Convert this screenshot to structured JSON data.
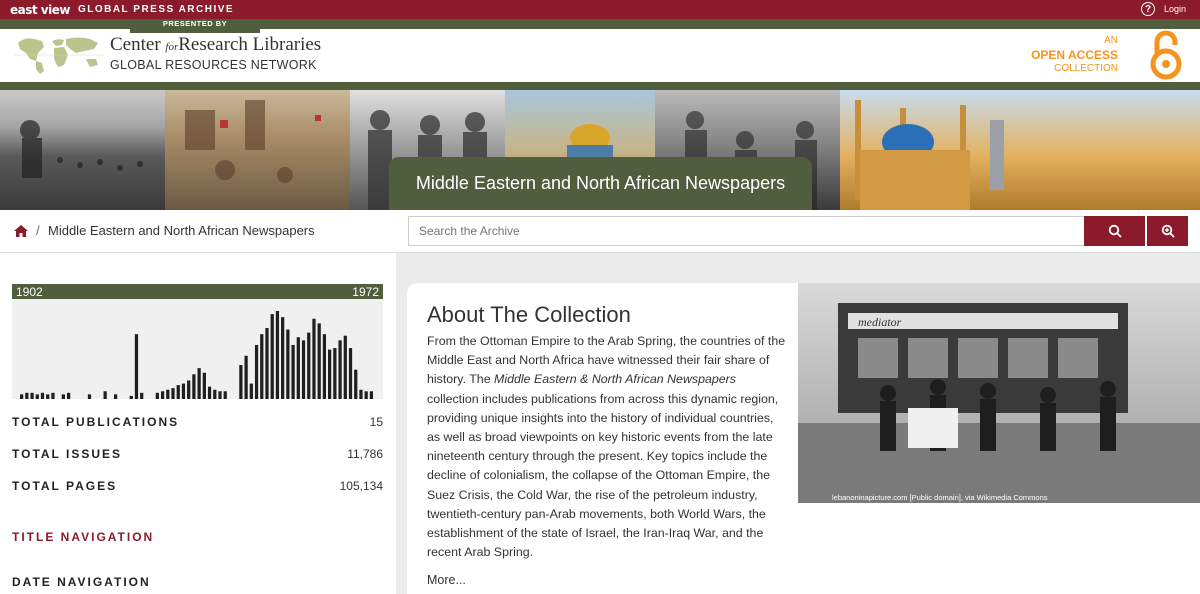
{
  "topbar": {
    "brand": "east view",
    "subtitle": "GLOBAL PRESS ARCHIVE",
    "help": "?",
    "login": "Login"
  },
  "header": {
    "presented_by": "PRESENTED BY",
    "crl_title_part1": "Center",
    "crl_title_for": "for",
    "crl_title_part2": "Research Libraries",
    "crl_network": "GLOBAL RESOURCES NETWORK",
    "oa_line1": "AN",
    "oa_line2": "OPEN ACCESS",
    "oa_line3": "COLLECTION"
  },
  "banner": {
    "title": "Middle Eastern and North African Newspapers"
  },
  "breadcrumb": {
    "separator": "/",
    "current": "Middle Eastern and North African Newspapers"
  },
  "search": {
    "placeholder": "Search the Archive"
  },
  "sidebar": {
    "year_start": "1902",
    "year_end": "1972",
    "stats": [
      {
        "label": "TOTAL PUBLICATIONS",
        "value": "15"
      },
      {
        "label": "TOTAL ISSUES",
        "value": "11,786"
      },
      {
        "label": "TOTAL PAGES",
        "value": "105,134"
      }
    ],
    "title_nav": "TITLE NAVIGATION",
    "date_nav": "DATE NAVIGATION"
  },
  "chart_data": {
    "type": "bar",
    "xlim": [
      1902,
      1972
    ],
    "values": [
      3,
      4,
      4,
      3,
      4,
      3,
      4,
      0,
      3,
      4,
      0,
      0,
      0,
      3,
      0,
      0,
      5,
      0,
      3,
      0,
      0,
      2,
      42,
      4,
      0,
      0,
      4,
      5,
      6,
      7,
      9,
      10,
      12,
      16,
      20,
      17,
      8,
      6,
      5,
      5,
      0,
      0,
      22,
      28,
      10,
      35,
      42,
      46,
      55,
      57,
      53,
      45,
      35,
      40,
      38,
      43,
      52,
      49,
      42,
      32,
      33,
      38,
      41,
      33,
      19,
      6,
      5,
      5
    ],
    "max_value": 57
  },
  "main": {
    "about_title": "About The Collection",
    "about_p1": "From the Ottoman Empire to the Arab Spring, the countries of the Middle East and North Africa have witnessed their fair share of history. The ",
    "about_italic": "Middle Eastern & North African Newspapers",
    "about_p2": " collection includes publications from across this dynamic region, providing unique insights into the history of individual countries, as well as broad viewpoints on key historic events from the late nineteenth century through the present. Key topics include the decline of colonialism, the collapse of the Ottoman Empire, the Suez Crisis, the Cold War, the rise of the petroleum industry, twentieth-century pan-Arab movements, both World Wars, the establishment of the state of Israel, the Iran-Iraq War, and the recent Arab Spring.",
    "more": "More...",
    "photo_credit": "lebanoninapicture.com [Public domain], via Wikimedia Commons",
    "photo_sign": "mediator"
  },
  "colors": {
    "brand_red": "#8b1a2b",
    "olive": "#515e3e",
    "oa_orange": "#f7931d"
  }
}
